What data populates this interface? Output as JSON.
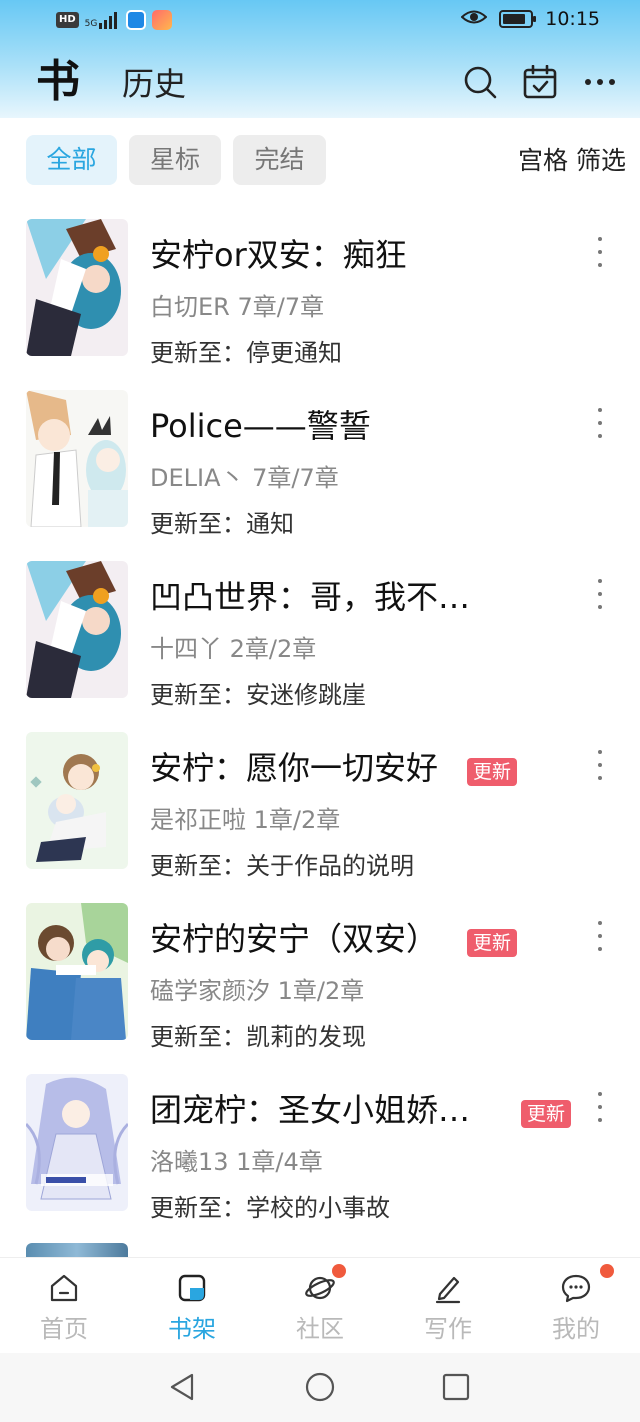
{
  "status_bar": {
    "network_badge": "HD",
    "signal": "5G",
    "time": "10:15",
    "battery_level": 0.85
  },
  "header": {
    "tab_book": "书",
    "tab_history": "历史",
    "icons": [
      "search-icon",
      "calendar-check-icon",
      "more-horizontal-icon"
    ]
  },
  "filters": {
    "chips": [
      {
        "label": "全部",
        "active": true
      },
      {
        "label": "星标",
        "active": false
      },
      {
        "label": "完结",
        "active": false
      }
    ],
    "grid_filter": "宫格 筛选"
  },
  "books": [
    {
      "title": "安柠or双安：痴狂",
      "meta": "白切ER  7章/7章",
      "update": "更新至：停更通知",
      "badge": ""
    },
    {
      "title": "Police——警誓",
      "meta": "DELIA丶  7章/7章",
      "update": "更新至：通知",
      "badge": ""
    },
    {
      "title": "凹凸世界：哥，我不…",
      "meta": "十四丫  2章/2章",
      "update": "更新至：安迷修跳崖",
      "badge": ""
    },
    {
      "title": "安柠：愿你一切安好",
      "meta": "是祁正啦  1章/2章",
      "update": "更新至：关于作品的说明",
      "badge": "更新"
    },
    {
      "title": "安柠的安宁（双安）",
      "meta": "磕学家颜汐  1章/2章",
      "update": "更新至：凯莉的发现",
      "badge": "更新"
    },
    {
      "title": "团宠柠：圣女小姐娇…",
      "meta": "洛曦13  1章/4章",
      "update": "更新至：学校的小事故",
      "badge": "更新"
    }
  ],
  "bottom_nav": [
    {
      "label": "首页",
      "icon": "home-icon",
      "active": false,
      "dot": false
    },
    {
      "label": "书架",
      "icon": "bookshelf-icon",
      "active": true,
      "dot": false
    },
    {
      "label": "社区",
      "icon": "planet-icon",
      "active": false,
      "dot": true
    },
    {
      "label": "写作",
      "icon": "pen-icon",
      "active": false,
      "dot": false
    },
    {
      "label": "我的",
      "icon": "chat-bubble-icon",
      "active": false,
      "dot": true
    }
  ],
  "colors": {
    "accent": "#2aa6e0",
    "badge": "#ef5d6c",
    "notification_dot": "#f05a3d"
  }
}
